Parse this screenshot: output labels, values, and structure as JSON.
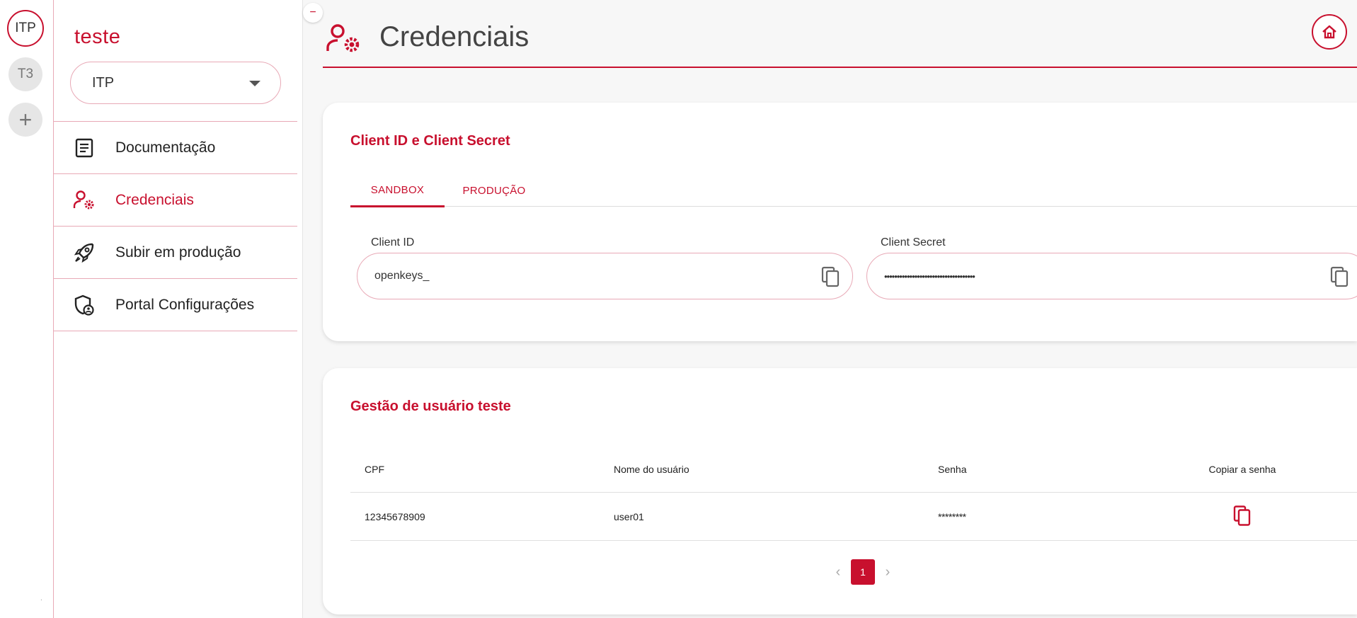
{
  "rail": {
    "items": [
      {
        "label": "ITP"
      },
      {
        "label": "T3"
      },
      {
        "label": "+"
      }
    ],
    "dot": "."
  },
  "sidebar": {
    "workspace_title": "teste",
    "select_value": "ITP",
    "collapse": "−",
    "items": [
      {
        "label": "Documentação",
        "icon": "document-icon"
      },
      {
        "label": "Credenciais",
        "icon": "user-gear-icon",
        "active": true
      },
      {
        "label": "Subir em produção",
        "icon": "rocket-icon"
      },
      {
        "label": "Portal Configurações",
        "icon": "shield-user-icon"
      }
    ]
  },
  "header": {
    "title": "Credenciais",
    "icon": "user-gear-icon",
    "home_icon": "home-icon"
  },
  "credentials": {
    "title": "Client ID e Client Secret",
    "tabs": [
      {
        "label": "SANDBOX",
        "active": true
      },
      {
        "label": "PRODUÇÃO"
      }
    ],
    "client_id": {
      "label": "Client ID",
      "value": "openkeys_"
    },
    "client_secret": {
      "label": "Client Secret",
      "value": "••••••••••••••••••••••••••••••••••••"
    }
  },
  "users": {
    "title": "Gestão de usuário teste",
    "columns": [
      "CPF",
      "Nome do usuário",
      "Senha",
      "Copiar a senha"
    ],
    "rows": [
      {
        "cpf": "12345678909",
        "nome": "user01",
        "senha": "********"
      }
    ],
    "pagination": {
      "current": "1"
    }
  },
  "colors": {
    "accent": "#c8102e",
    "border": "#e8a9b6"
  }
}
